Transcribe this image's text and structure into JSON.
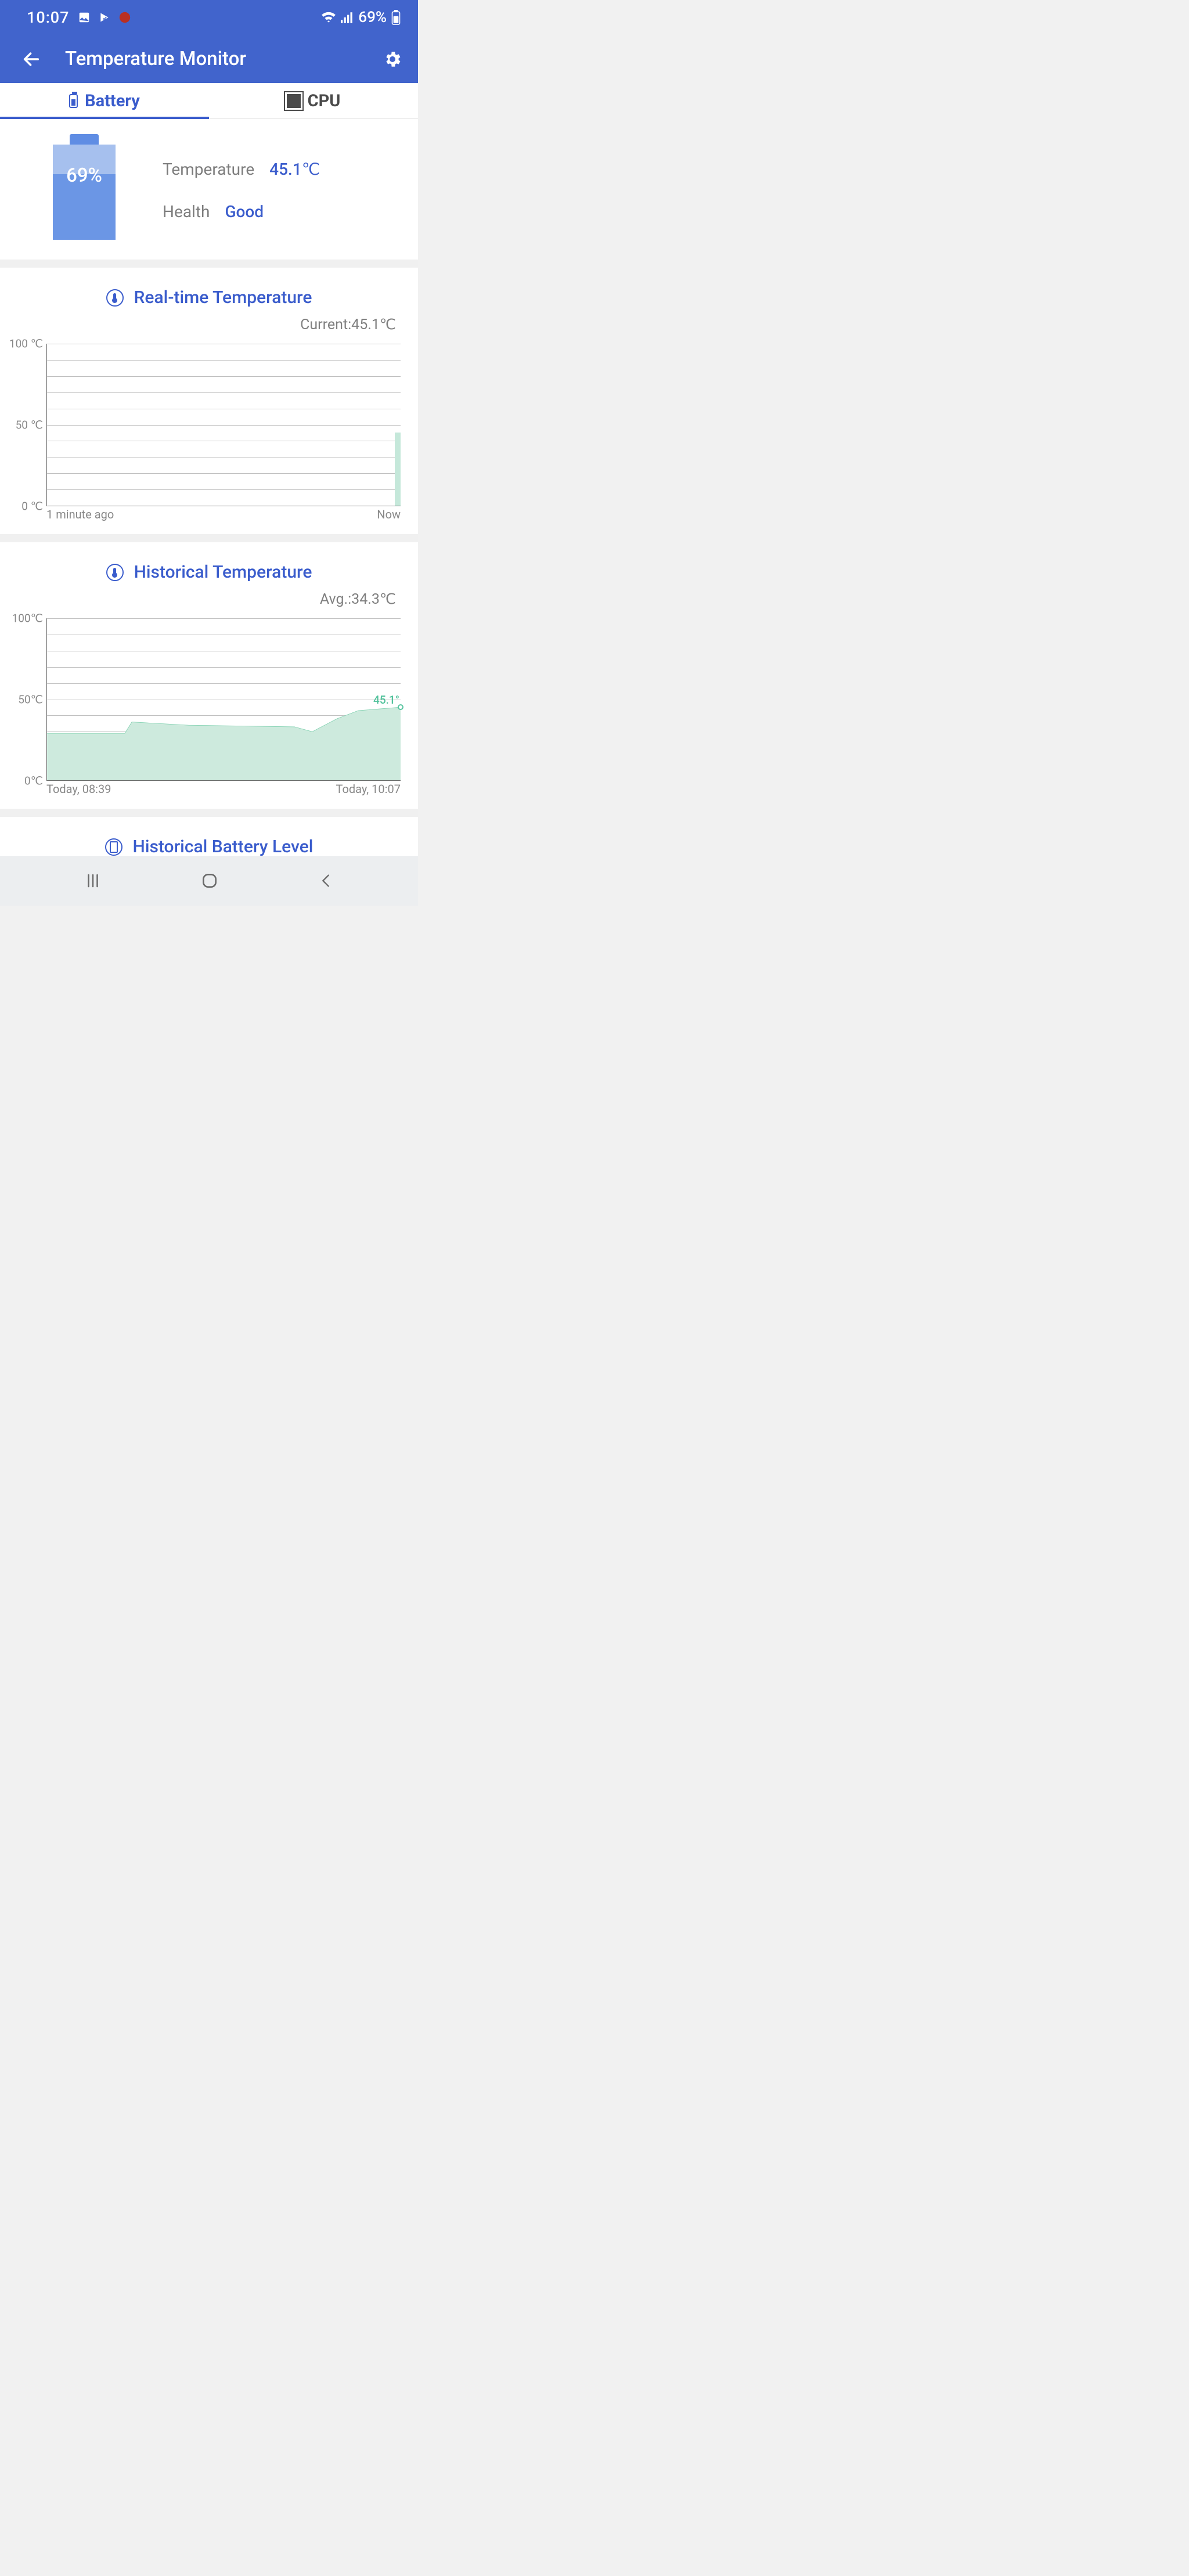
{
  "status": {
    "time": "10:07",
    "battery_pct": "69%"
  },
  "appbar": {
    "title": "Temperature Monitor"
  },
  "tabs": {
    "battery": "Battery",
    "cpu": "CPU"
  },
  "summary": {
    "battery_pct": "69%",
    "fill_pct": 69,
    "temp_label": "Temperature",
    "temp_value": "45.1℃",
    "health_label": "Health",
    "health_value": "Good"
  },
  "realtime": {
    "title": "Real-time Temperature",
    "sub_prefix": "Current:",
    "sub_value": "45.1℃",
    "x_left": "1 minute ago",
    "x_right": "Now",
    "y_ticks": [
      "100 ℃",
      "50 ℃",
      "0 ℃"
    ]
  },
  "historical": {
    "title": "Historical Temperature",
    "sub_prefix": "Avg.:",
    "sub_value": "34.3℃",
    "x_left": "Today, 08:39",
    "x_right": "Today, 10:07",
    "y_ticks": [
      "100℃",
      "50℃",
      "0℃"
    ],
    "end_label": "45.1°"
  },
  "hist_batt": {
    "title": "Historical Battery Level"
  },
  "chart_data": [
    {
      "type": "bar",
      "title": "Real-time Temperature",
      "xlabel": "",
      "ylabel": "℃",
      "ylim": [
        0,
        100
      ],
      "x_ticks": [
        "1 minute ago",
        "Now"
      ],
      "series": [
        {
          "name": "battery_temp",
          "values": [
            45.1
          ]
        }
      ],
      "note": "Only the current instant bar is rendered at the far right (~45.1℃); earlier minute is empty."
    },
    {
      "type": "area",
      "title": "Historical Temperature",
      "xlabel": "",
      "ylabel": "℃",
      "ylim": [
        0,
        100
      ],
      "x_range": [
        "Today, 08:39",
        "Today, 10:07"
      ],
      "series": [
        {
          "name": "battery_temp",
          "x_pct": [
            0,
            22,
            24,
            40,
            70,
            75,
            82,
            88,
            100
          ],
          "values": [
            29,
            29,
            36,
            34,
            33,
            30,
            38,
            43,
            45.1
          ]
        }
      ],
      "end_value_label": "45.1°",
      "avg": 34.3
    }
  ]
}
